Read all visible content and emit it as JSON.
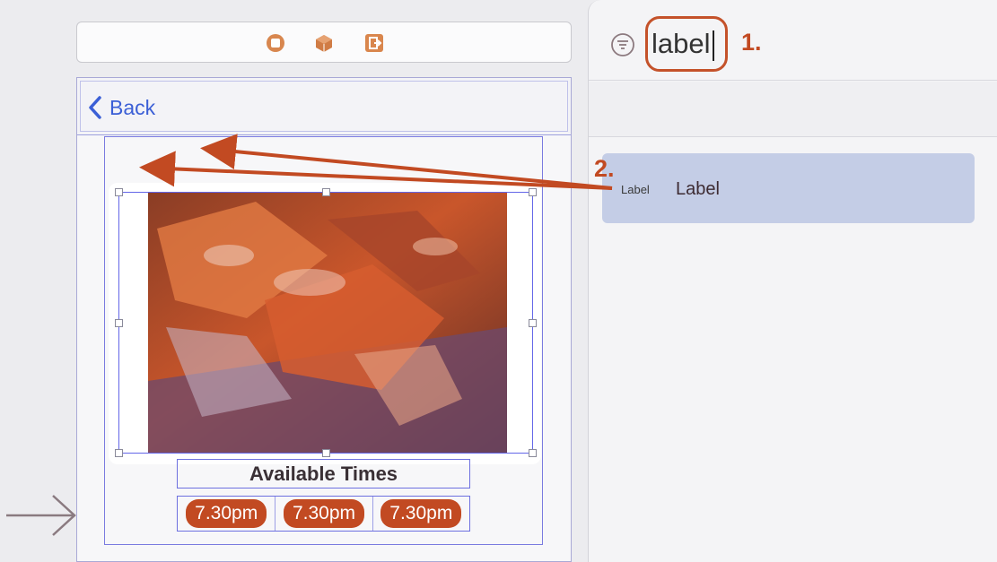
{
  "canvas": {
    "nav": {
      "back_label": "Back"
    },
    "image": {
      "alt": "food photo"
    },
    "times": {
      "title": "Available Times",
      "slots": [
        "7.30pm",
        "7.30pm",
        "7.30pm"
      ]
    }
  },
  "library": {
    "search": {
      "value": "label"
    },
    "results": [
      {
        "icon_text": "Label",
        "label": "Label"
      }
    ]
  },
  "annotations": {
    "step1": "1.",
    "step2": "2."
  },
  "colors": {
    "accent_annotation": "#c24a22",
    "selection": "#6366e8",
    "link": "#3b5fd6",
    "result_highlight": "#c4cde6"
  },
  "icons": [
    "view-controller-icon",
    "cube-icon",
    "exit-icon",
    "filter-icon",
    "back-chevron-icon",
    "entry-arrow-icon"
  ]
}
